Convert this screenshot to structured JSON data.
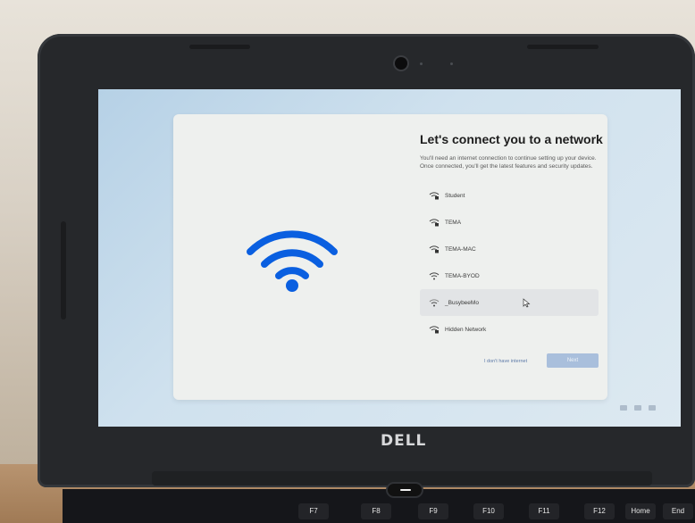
{
  "brand": "DELL",
  "setup": {
    "title": "Let's connect you to a network",
    "description": "You'll need an internet connection to continue setting up your device. Once connected, you'll get the latest features and security updates.",
    "networks": [
      {
        "name": "Student",
        "secured": true
      },
      {
        "name": "TEMA",
        "secured": true
      },
      {
        "name": "TEMA-MAC",
        "secured": true
      },
      {
        "name": "TEMA-BYOD",
        "secured": false
      },
      {
        "name": "_BusybeeMo",
        "secured": false
      },
      {
        "name": "Hidden Network",
        "secured": true
      }
    ],
    "skip_label": "I don't have internet",
    "next_label": "Next"
  },
  "keyboard": {
    "keys": [
      "F7",
      "F8",
      "F9",
      "F10",
      "F11",
      "F12",
      "Home",
      "End"
    ]
  },
  "colors": {
    "accent": "#0a5fe0",
    "next_button": "#a9bfdc",
    "card": "#eef0ee"
  },
  "icons": [
    "wifi-icon",
    "wifi-lock-icon",
    "mouse-cursor-icon"
  ]
}
